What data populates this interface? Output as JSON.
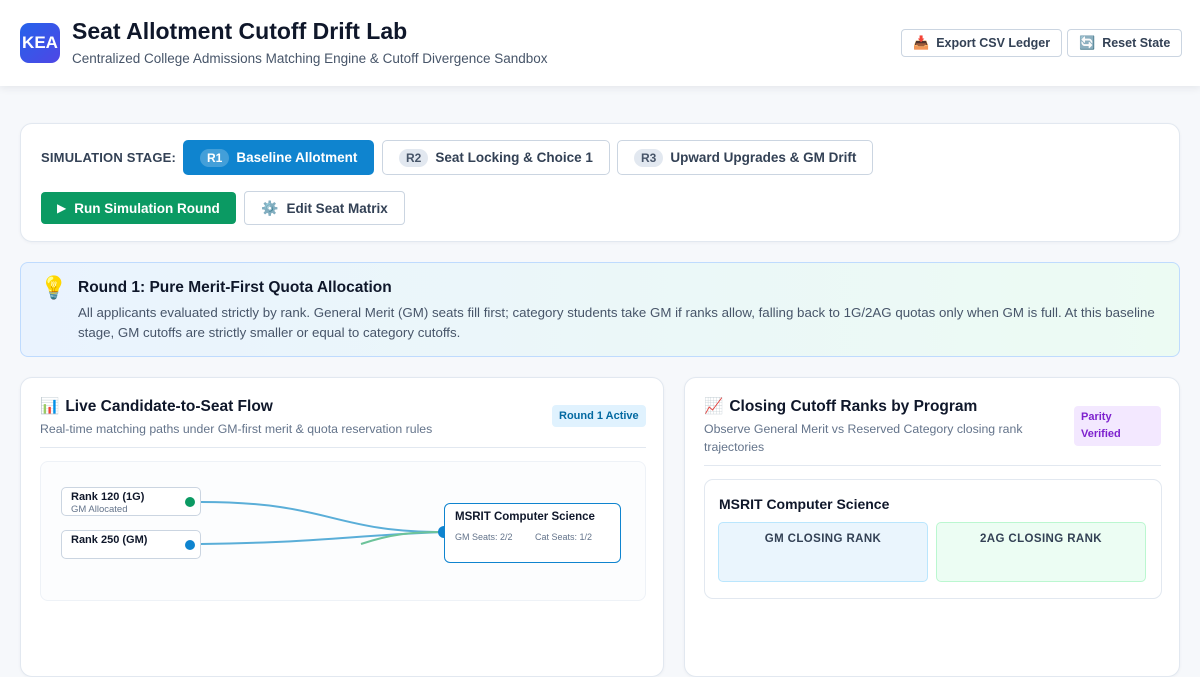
{
  "header": {
    "logo": "KEA",
    "title": "Seat Allotment Cutoff Drift Lab",
    "subtitle": "Centralized College Admissions Matching Engine & Cutoff Divergence Sandbox",
    "export_icon": "📥",
    "export_label": "Export CSV Ledger",
    "reset_icon": "🔄",
    "reset_label": "Reset State"
  },
  "controls": {
    "stage_label": "SIMULATION STAGE:",
    "stages": [
      {
        "tag": "R1",
        "label": "Baseline Allotment",
        "active": true
      },
      {
        "tag": "R2",
        "label": "Seat Locking & Choice 1",
        "active": false
      },
      {
        "tag": "R3",
        "label": "Upward Upgrades & GM Drift",
        "active": false
      }
    ],
    "run_icon": "▶",
    "run_label": "Run Simulation Round",
    "edit_icon": "⚙️",
    "edit_label": "Edit Seat Matrix"
  },
  "info": {
    "icon": "💡",
    "title": "Round 1: Pure Merit-First Quota Allocation",
    "body": "All applicants evaluated strictly by rank. General Merit (GM) seats fill first; category students take GM if ranks allow, falling back to 1G/2AG quotas only when GM is full. At this baseline stage, GM cutoffs are strictly smaller or equal to category cutoffs."
  },
  "flow_panel": {
    "icon": "📊",
    "title": "Live Candidate-to-Seat Flow",
    "subtitle": "Real-time matching paths under GM-first merit & quota reservation rules",
    "badge": "Round 1 Active",
    "candidates": [
      {
        "label": "Rank 120 (1G)",
        "status": "GM Allocated",
        "color": "#0b9a63"
      },
      {
        "label": "Rank 250 (GM)",
        "status": "",
        "color": "#0f84cf"
      }
    ],
    "program": {
      "name": "MSRIT Computer Science",
      "gm_seats": "GM Seats: 2/2",
      "cat_seats": "Cat Seats: 1/2"
    },
    "colors": {
      "blue_path": "#5aaed8",
      "green_path": "#6cc39a",
      "node": "#0f84cf"
    }
  },
  "cutoff_panel": {
    "icon": "📈",
    "title": "Closing Cutoff Ranks by Program",
    "subtitle": "Observe General Merit vs Reserved Category closing rank trajectories",
    "badge": "Parity Verified",
    "program_name": "MSRIT Computer Science",
    "gm_label": "GM CLOSING RANK",
    "cat_label": "2AG CLOSING RANK"
  }
}
